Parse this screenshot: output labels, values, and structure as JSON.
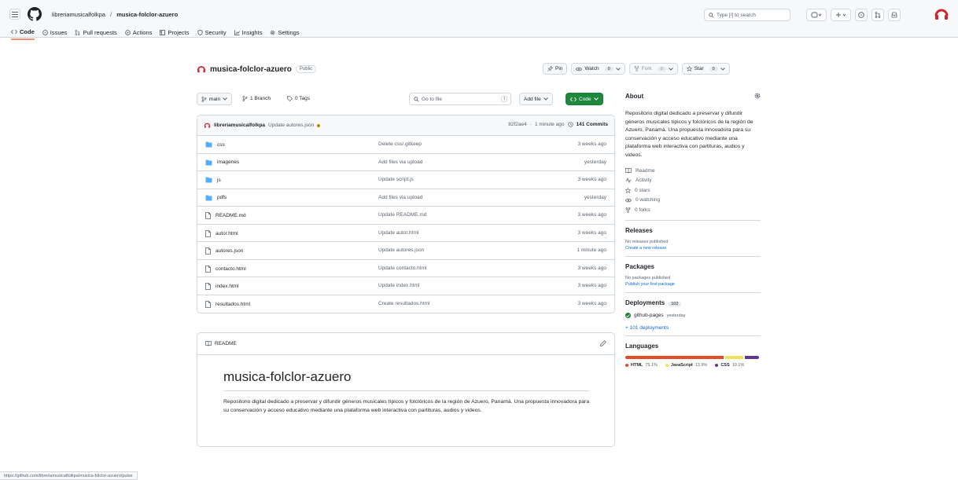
{
  "header": {
    "owner": "libreriamusicalfolkpa",
    "separator": "/",
    "repo": "musica-folclor-azuero",
    "search_placeholder": "Type [/] to search"
  },
  "tabs": [
    {
      "label": "Code",
      "icon": "code-icon",
      "active": true
    },
    {
      "label": "Issues",
      "icon": "issue-icon"
    },
    {
      "label": "Pull requests",
      "icon": "pull-request-icon"
    },
    {
      "label": "Actions",
      "icon": "actions-icon"
    },
    {
      "label": "Projects",
      "icon": "projects-icon"
    },
    {
      "label": "Security",
      "icon": "shield-icon"
    },
    {
      "label": "Insights",
      "icon": "graph-icon"
    },
    {
      "label": "Settings",
      "icon": "gear-icon"
    }
  ],
  "repo": {
    "name": "musica-folclor-azuero",
    "visibility": "Public",
    "pin_label": "Pin",
    "watch_label": "Watch",
    "watch_count": "0",
    "fork_label": "Fork",
    "fork_count": "0",
    "star_label": "Star",
    "star_count": "0"
  },
  "toolbar": {
    "branch": "main",
    "branch_count": "1 Branch",
    "tag_count": "0 Tags",
    "go_to_file": "Go to file",
    "kbd": "t",
    "add_file": "Add file",
    "code": "Code"
  },
  "latest_commit": {
    "author": "libreriamusicalfolkpa",
    "message": "Update autores.json",
    "hash": "82f2ae4",
    "time": "1 minute ago",
    "commits": "141 Commits"
  },
  "files": [
    {
      "type": "dir",
      "name": "css",
      "message": "Delete css/.gitkeep",
      "date": "3 weeks ago"
    },
    {
      "type": "dir",
      "name": "imagenes",
      "message": "Add files via upload",
      "date": "yesterday"
    },
    {
      "type": "dir",
      "name": "js",
      "message": "Update script.js",
      "date": "3 weeks ago"
    },
    {
      "type": "dir",
      "name": "pdfs",
      "message": "Add files via upload",
      "date": "yesterday"
    },
    {
      "type": "file",
      "name": "README.md",
      "message": "Update README.md",
      "date": "3 weeks ago"
    },
    {
      "type": "file",
      "name": "autor.html",
      "message": "Update autor.html",
      "date": "3 weeks ago"
    },
    {
      "type": "file",
      "name": "autores.json",
      "message": "Update autores.json",
      "date": "1 minute ago"
    },
    {
      "type": "file",
      "name": "contacto.html",
      "message": "Update contacto.html",
      "date": "3 weeks ago"
    },
    {
      "type": "file",
      "name": "index.html",
      "message": "Update index.html",
      "date": "3 weeks ago"
    },
    {
      "type": "file",
      "name": "resultados.html",
      "message": "Create resultados.html",
      "date": "3 weeks ago"
    }
  ],
  "readme": {
    "label": "README",
    "title": "musica-folclor-azuero",
    "body": "Repositorio digital dedicado a preservar y difundir géneros musicales típicos y folclóricos de la región de Azuero, Panamá. Una propuesta innovadora para su conservación y acceso educativo mediante una plataforma web interactiva con partituras, audios y videos."
  },
  "about": {
    "title": "About",
    "description": "Repositorio digital dedicado a preservar y difundir géneros musicales típicos y folclóricos de la región de Azuero, Panamá. Una propuesta innovadora para su conservación y acceso educativo mediante una plataforma web interactiva con partituras, audios y videos.",
    "items": [
      {
        "icon": "book-icon",
        "label": "Readme"
      },
      {
        "icon": "pulse-icon",
        "label": "Activity"
      },
      {
        "icon": "star-icon",
        "label": "0 stars"
      },
      {
        "icon": "eye-icon",
        "label": "0 watching"
      },
      {
        "icon": "fork-icon",
        "label": "0 forks"
      }
    ]
  },
  "releases": {
    "title": "Releases",
    "empty": "No releases published",
    "create": "Create a new release"
  },
  "packages": {
    "title": "Packages",
    "empty": "No packages published",
    "publish": "Publish your first package"
  },
  "deployments": {
    "title": "Deployments",
    "count": "102",
    "env": "github-pages",
    "time": "yesterday",
    "more": "+ 101 deployments"
  },
  "languages": {
    "title": "Languages",
    "items": [
      {
        "name": "HTML",
        "percent": "75.1%",
        "value": 75.1,
        "color": "#e34c26"
      },
      {
        "name": "JavaScript",
        "percent": "13.9%",
        "value": 13.9,
        "color": "#f1e05a"
      },
      {
        "name": "CSS",
        "percent": "10.1%",
        "value": 11.0,
        "color": "#663399"
      }
    ]
  },
  "status_url": "https://github.com/libreriamusicalfolkpa/musica-folclor-azuero/pulse",
  "colors": {
    "accent": "#0969da",
    "code_button": "#1f883d",
    "tab_underline": "#fd8c73",
    "folder": "#54aeff"
  }
}
